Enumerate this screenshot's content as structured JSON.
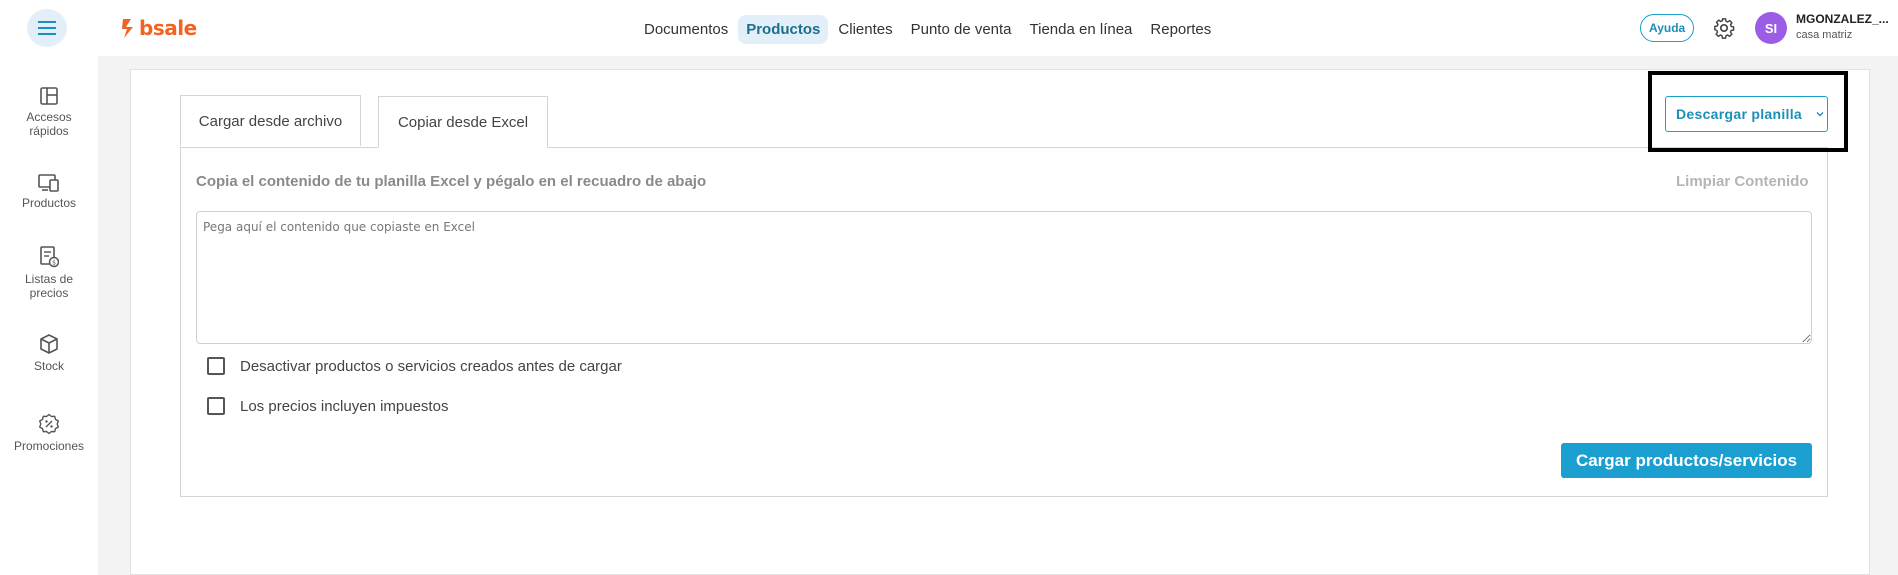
{
  "app": {
    "logo_text": "bsale"
  },
  "nav": {
    "items": [
      "Documentos",
      "Productos",
      "Clientes",
      "Punto de venta",
      "Tienda en línea",
      "Reportes"
    ],
    "active": "Productos"
  },
  "header": {
    "help_label": "Ayuda",
    "avatar_initials": "SI",
    "user_name": "MGONZALEZ_...",
    "user_branch": "casa matriz"
  },
  "sidebar": {
    "items": [
      {
        "label": "Accesos rápidos",
        "icon": "layout-icon"
      },
      {
        "label": "Productos",
        "icon": "devices-icon"
      },
      {
        "label": "Listas de precios",
        "icon": "price-list-icon"
      },
      {
        "label": "Stock",
        "icon": "box-icon"
      },
      {
        "label": "Promociones",
        "icon": "percent-badge-icon"
      }
    ]
  },
  "tabs": {
    "upload_file": "Cargar desde archivo",
    "copy_excel": "Copiar desde Excel",
    "active": "Copiar desde Excel"
  },
  "download": {
    "label": "Descargar planilla"
  },
  "form": {
    "instructions": "Copia el contenido de tu planilla Excel y pégalo en el recuadro de abajo",
    "clear_label": "Limpiar Contenido",
    "paste_placeholder": "Pega aquí el contenido que copiaste en Excel",
    "paste_value": "",
    "checkbox_deactivate": "Desactivar productos o servicios creados antes de cargar",
    "checkbox_taxes": "Los precios incluyen impuestos",
    "submit_label": "Cargar productos/servicios"
  },
  "colors": {
    "brand": "#f26322",
    "accent": "#1a9fd0",
    "avatar": "#9b5de5",
    "nav_active_bg": "#e3eff8"
  }
}
